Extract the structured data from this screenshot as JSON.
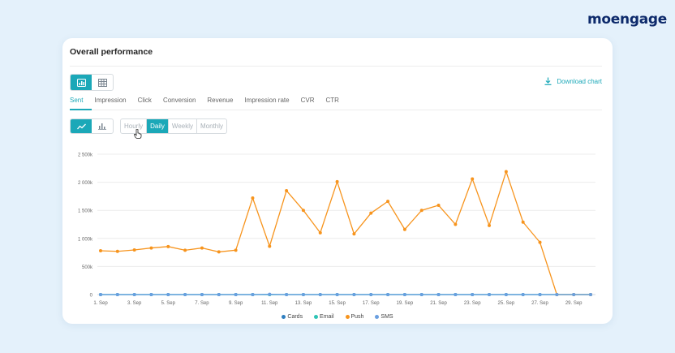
{
  "brand": {
    "logo_text": "moengage"
  },
  "card": {
    "title": "Overall performance"
  },
  "toolbar": {
    "view_buttons": [
      {
        "icon": "chart-view-icon",
        "active": true
      },
      {
        "icon": "table-view-icon",
        "active": false
      }
    ],
    "download_label": "Download chart"
  },
  "metric_tabs": [
    "Sent",
    "Impression",
    "Click",
    "Conversion",
    "Revenue",
    "Impression rate",
    "CVR",
    "CTR"
  ],
  "active_metric": "Sent",
  "chart_type_buttons": [
    {
      "icon": "line-chart-icon",
      "active": true
    },
    {
      "icon": "bar-chart-icon",
      "active": false
    }
  ],
  "periods": [
    "Hourly",
    "Daily",
    "Weekly",
    "Monthly"
  ],
  "active_period": "Daily",
  "colors": {
    "accent": "#1ba8b8",
    "cards": "#2f7fc0",
    "email": "#2ec4b6",
    "push": "#f7941d",
    "sms": "#6a9fe0"
  },
  "chart_data": {
    "type": "line",
    "x": [
      "1. Sep",
      "2. Sep",
      "3. Sep",
      "4. Sep",
      "5. Sep",
      "6. Sep",
      "7. Sep",
      "8. Sep",
      "9. Sep",
      "10. Sep",
      "11. Sep",
      "12. Sep",
      "13. Sep",
      "14. Sep",
      "15. Sep",
      "16. Sep",
      "17. Sep",
      "18. Sep",
      "19. Sep",
      "20. Sep",
      "21. Sep",
      "22. Sep",
      "23. Sep",
      "24. Sep",
      "25. Sep",
      "26. Sep",
      "27. Sep",
      "28. Sep",
      "29. Sep",
      "30. Sep"
    ],
    "x_tick_labels": [
      "1. Sep",
      "3. Sep",
      "5. Sep",
      "7. Sep",
      "9. Sep",
      "11. Sep",
      "13. Sep",
      "15. Sep",
      "17. Sep",
      "19. Sep",
      "21. Sep",
      "23. Sep",
      "25. Sep",
      "27. Sep",
      "29. Sep"
    ],
    "y_tick_labels": [
      "0",
      "500k",
      "1 000k",
      "1 500k",
      "2 000k",
      "2 500k"
    ],
    "ylim": [
      0,
      2500000
    ],
    "series": [
      {
        "name": "Cards",
        "color": "#2f7fc0",
        "values": [
          0,
          0,
          0,
          0,
          0,
          0,
          0,
          0,
          0,
          0,
          0,
          0,
          0,
          0,
          0,
          0,
          0,
          0,
          0,
          0,
          0,
          0,
          0,
          0,
          0,
          0,
          0,
          0,
          0,
          0
        ]
      },
      {
        "name": "Email",
        "color": "#2ec4b6",
        "values": [
          0,
          0,
          0,
          0,
          0,
          0,
          0,
          0,
          0,
          0,
          0,
          0,
          0,
          0,
          0,
          0,
          0,
          0,
          0,
          0,
          0,
          0,
          0,
          0,
          0,
          0,
          0,
          0,
          0,
          0
        ]
      },
      {
        "name": "Push",
        "color": "#f7941d",
        "values": [
          780000,
          770000,
          795000,
          830000,
          855000,
          790000,
          830000,
          760000,
          790000,
          1720000,
          860000,
          1850000,
          1500000,
          1100000,
          2010000,
          1080000,
          1450000,
          1660000,
          1160000,
          1500000,
          1590000,
          1250000,
          2060000,
          1230000,
          2190000,
          1290000,
          930000,
          0,
          0,
          0
        ]
      },
      {
        "name": "SMS",
        "color": "#6a9fe0",
        "values": [
          0,
          0,
          0,
          0,
          0,
          0,
          0,
          0,
          0,
          0,
          5000,
          0,
          0,
          0,
          0,
          0,
          0,
          0,
          0,
          0,
          0,
          0,
          0,
          0,
          0,
          0,
          0,
          0,
          0,
          0
        ]
      }
    ],
    "grid": true,
    "legend": "bottom-center"
  }
}
